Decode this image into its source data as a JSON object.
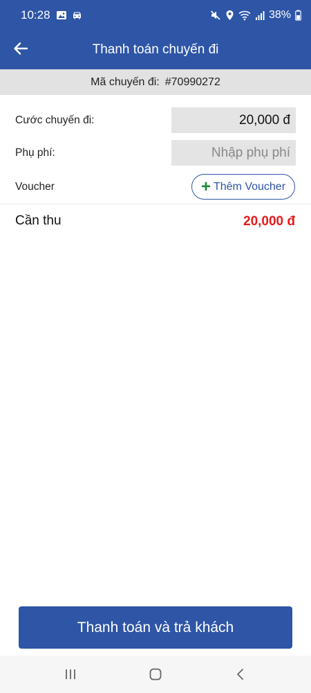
{
  "status_bar": {
    "time": "10:28",
    "battery": "38%"
  },
  "app_bar": {
    "title": "Thanh toán chuyến đi"
  },
  "trip": {
    "code_label": "Mã chuyến đi:",
    "code_value": "#70990272"
  },
  "form": {
    "fare_label": "Cước chuyến đi:",
    "fare_value": "20,000 đ",
    "surcharge_label": "Phụ phí:",
    "surcharge_placeholder": "Nhập phụ phí",
    "voucher_label": "Voucher",
    "voucher_button": "Thêm Voucher"
  },
  "summary": {
    "total_label": "Cần thu",
    "total_value": "20,000 đ"
  },
  "actions": {
    "pay_button": "Thanh toán và trả khách"
  },
  "colors": {
    "primary": "#2e55a6",
    "total": "#e21b1b",
    "voucher_plus": "#1f8a3a"
  }
}
